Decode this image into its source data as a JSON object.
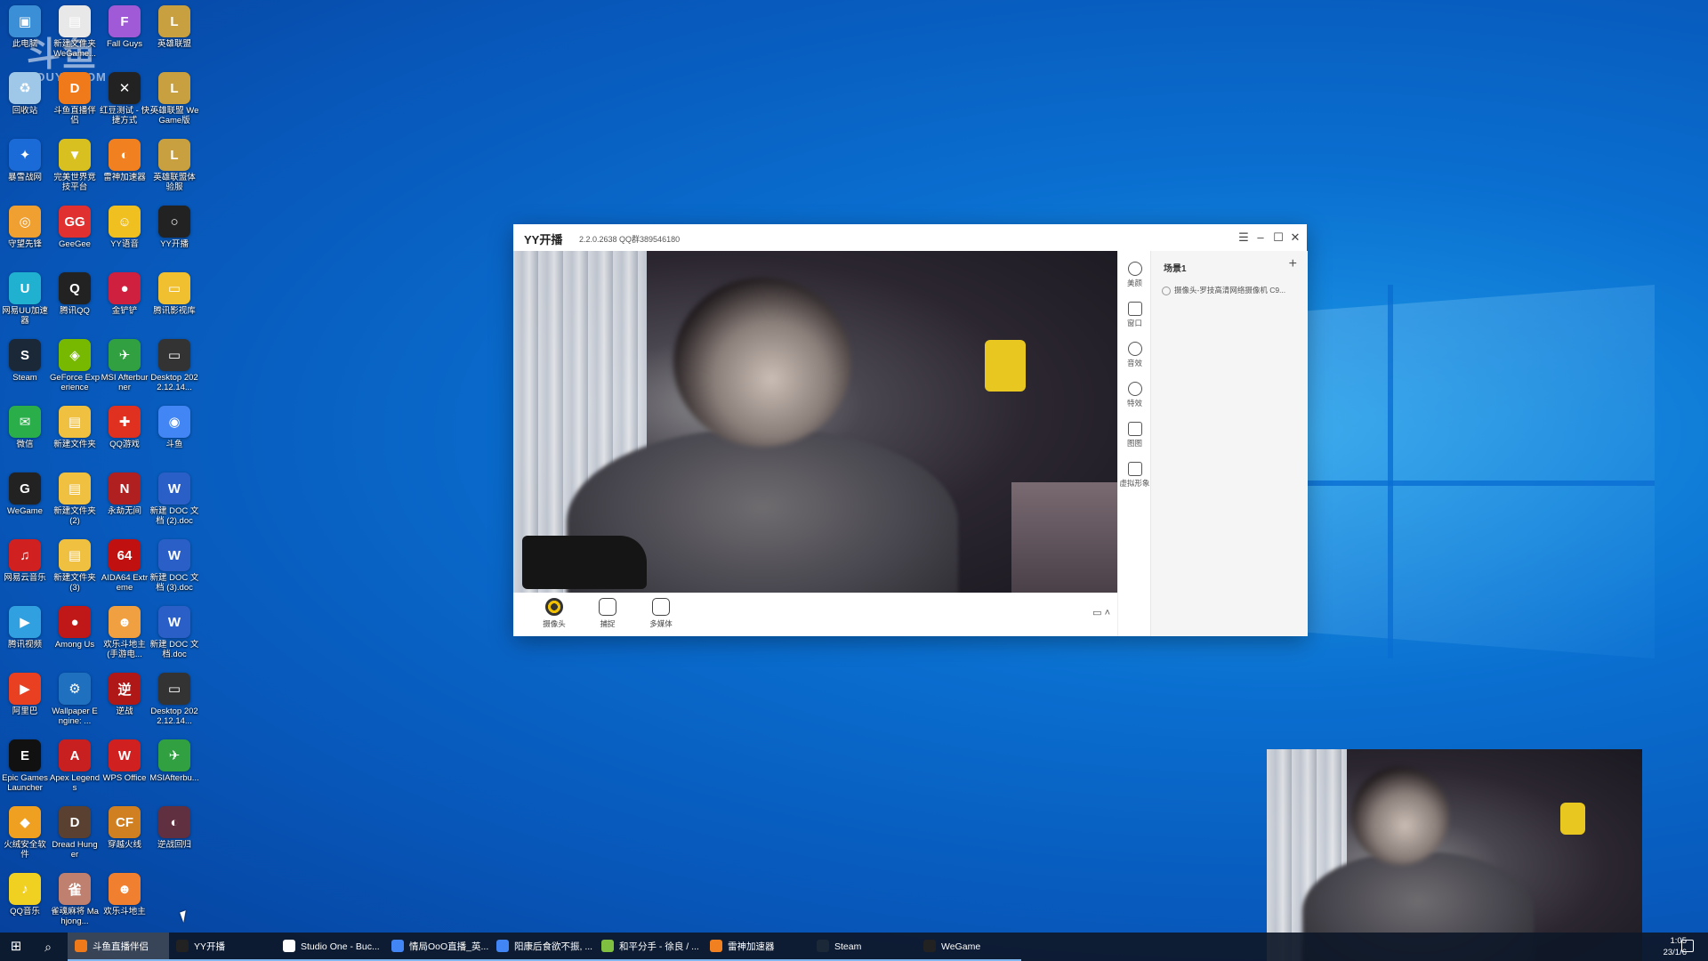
{
  "watermark": {
    "big": "斗鱼",
    "small": "DOUYU.COM"
  },
  "desktop": {
    "icons": [
      {
        "label": "此电脑",
        "color": "#3b8fd6",
        "glyph": "▣"
      },
      {
        "label": "新建文件夹 WeGame...",
        "color": "#e8e8e8",
        "glyph": "▤"
      },
      {
        "label": "Fall Guys",
        "color": "#a05ad8",
        "glyph": "F"
      },
      {
        "label": "英雄联盟",
        "color": "#c8a040",
        "glyph": "L"
      },
      {
        "label": "回收站",
        "color": "#9fc8e8",
        "glyph": "♻"
      },
      {
        "label": "斗鱼直播伴侣",
        "color": "#f07a1a",
        "glyph": "D"
      },
      {
        "label": "红豆测试 - 快捷方式",
        "color": "#222",
        "glyph": "✕"
      },
      {
        "label": "英雄联盟 WeGame版",
        "color": "#c8a040",
        "glyph": "L"
      },
      {
        "label": "暴雪战网",
        "color": "#1a6ad8",
        "glyph": "✦"
      },
      {
        "label": "完美世界竞技平台",
        "color": "#d8c020",
        "glyph": "▼"
      },
      {
        "label": "雷神加速器",
        "color": "#f08020",
        "glyph": "◐"
      },
      {
        "label": "英雄联盟体验服",
        "color": "#c8a040",
        "glyph": "L"
      },
      {
        "label": "守望先锋",
        "color": "#f0a030",
        "glyph": "◎"
      },
      {
        "label": "GeeGee",
        "color": "#e03030",
        "glyph": "GG"
      },
      {
        "label": "YY语音",
        "color": "#f0c020",
        "glyph": "☺"
      },
      {
        "label": "YY开播",
        "color": "#222",
        "glyph": "○"
      },
      {
        "label": "网易UU加速器",
        "color": "#20b0d0",
        "glyph": "U"
      },
      {
        "label": "腾讯QQ",
        "color": "#222",
        "glyph": "Q"
      },
      {
        "label": "金铲铲",
        "color": "#d02040",
        "glyph": "●"
      },
      {
        "label": "腾讯影视库",
        "color": "#f0c030",
        "glyph": "▭"
      },
      {
        "label": "Steam",
        "color": "#1b2838",
        "glyph": "S"
      },
      {
        "label": "GeForce Experience",
        "color": "#76b900",
        "glyph": "◈"
      },
      {
        "label": "MSI Afterburner",
        "color": "#30a040",
        "glyph": "✈"
      },
      {
        "label": "Desktop 2022.12.14...",
        "color": "#333",
        "glyph": "▭"
      },
      {
        "label": "微信",
        "color": "#2aae4a",
        "glyph": "✉"
      },
      {
        "label": "新建文件夹",
        "color": "#f0c040",
        "glyph": "▤"
      },
      {
        "label": "QQ游戏",
        "color": "#e03020",
        "glyph": "✚"
      },
      {
        "label": "斗鱼",
        "color": "#4285f4",
        "glyph": "◉"
      },
      {
        "label": "WeGame",
        "color": "#222",
        "glyph": "G"
      },
      {
        "label": "新建文件夹 (2)",
        "color": "#f0c040",
        "glyph": "▤"
      },
      {
        "label": "永劫无间",
        "color": "#b02020",
        "glyph": "N"
      },
      {
        "label": "新建 DOC 文档 (2).doc",
        "color": "#2b5fc8",
        "glyph": "W"
      },
      {
        "label": "网易云音乐",
        "color": "#d02020",
        "glyph": "♫"
      },
      {
        "label": "新建文件夹 (3)",
        "color": "#f0c040",
        "glyph": "▤"
      },
      {
        "label": "AIDA64 Extreme",
        "color": "#c01010",
        "glyph": "64"
      },
      {
        "label": "新建 DOC 文档 (3).doc",
        "color": "#2b5fc8",
        "glyph": "W"
      },
      {
        "label": "腾讯视频",
        "color": "#30a0e0",
        "glyph": "▶"
      },
      {
        "label": "Among Us",
        "color": "#c01818",
        "glyph": "●"
      },
      {
        "label": "欢乐斗地主(手游电...",
        "color": "#f0a040",
        "glyph": "☻"
      },
      {
        "label": "新建 DOC 文档.doc",
        "color": "#2b5fc8",
        "glyph": "W"
      },
      {
        "label": "阿里巴",
        "color": "#e84020",
        "glyph": "▶"
      },
      {
        "label": "Wallpaper Engine: ...",
        "color": "#2070c0",
        "glyph": "⚙"
      },
      {
        "label": "逆战",
        "color": "#b01818",
        "glyph": "逆"
      },
      {
        "label": "Desktop 2022.12.14...",
        "color": "#333",
        "glyph": "▭"
      },
      {
        "label": "Epic Games Launcher",
        "color": "#111",
        "glyph": "E"
      },
      {
        "label": "Apex Legends",
        "color": "#c82020",
        "glyph": "A"
      },
      {
        "label": "WPS Office",
        "color": "#d02020",
        "glyph": "W"
      },
      {
        "label": "MSIAfterbu...",
        "color": "#30a040",
        "glyph": "✈"
      },
      {
        "label": "火绒安全软件",
        "color": "#f0a020",
        "glyph": "◆"
      },
      {
        "label": "Dread Hunger",
        "color": "#5a4030",
        "glyph": "D"
      },
      {
        "label": "穿越火线",
        "color": "#d08020",
        "glyph": "CF"
      },
      {
        "label": "逆战回归",
        "color": "#603040",
        "glyph": "◐"
      },
      {
        "label": "QQ音乐",
        "color": "#f0d020",
        "glyph": "♪"
      },
      {
        "label": "雀魂麻将 Mahjong...",
        "color": "#c08070",
        "glyph": "雀"
      },
      {
        "label": "欢乐斗地主",
        "color": "#f08030",
        "glyph": "☻"
      }
    ]
  },
  "yy": {
    "title": "YY开播",
    "version": "2.2.0.2638 QQ群389546180",
    "scene_name": "场景1",
    "source_item": "摄像头-罗技高清网络摄像机 C9...",
    "side_tools": [
      "美颜",
      "窗口",
      "音效",
      "特效",
      "图图",
      "虚拟形象"
    ],
    "bottom_tools": [
      "摄像头",
      "捕捉",
      "多媒体"
    ]
  },
  "taskbar": {
    "items": [
      {
        "label": "斗鱼直播伴侣",
        "color": "#f07a1a",
        "active": true
      },
      {
        "label": "YY开播",
        "color": "#222",
        "active": false
      },
      {
        "label": "Studio One - Buc...",
        "color": "#fff",
        "active": false
      },
      {
        "label": "情局OoO直播_英...",
        "color": "#4285f4",
        "active": false
      },
      {
        "label": "阳康后食欲不振, ...",
        "color": "#4285f4",
        "active": false
      },
      {
        "label": "和平分手 - 徐良 / ...",
        "color": "#80c040",
        "active": false
      },
      {
        "label": "雷神加速器",
        "color": "#f08020",
        "active": false
      },
      {
        "label": "Steam",
        "color": "#1b2838",
        "active": false
      },
      {
        "label": "WeGame",
        "color": "#222",
        "active": false
      }
    ],
    "clock_time": "1:05",
    "clock_date": "23/1/6"
  }
}
